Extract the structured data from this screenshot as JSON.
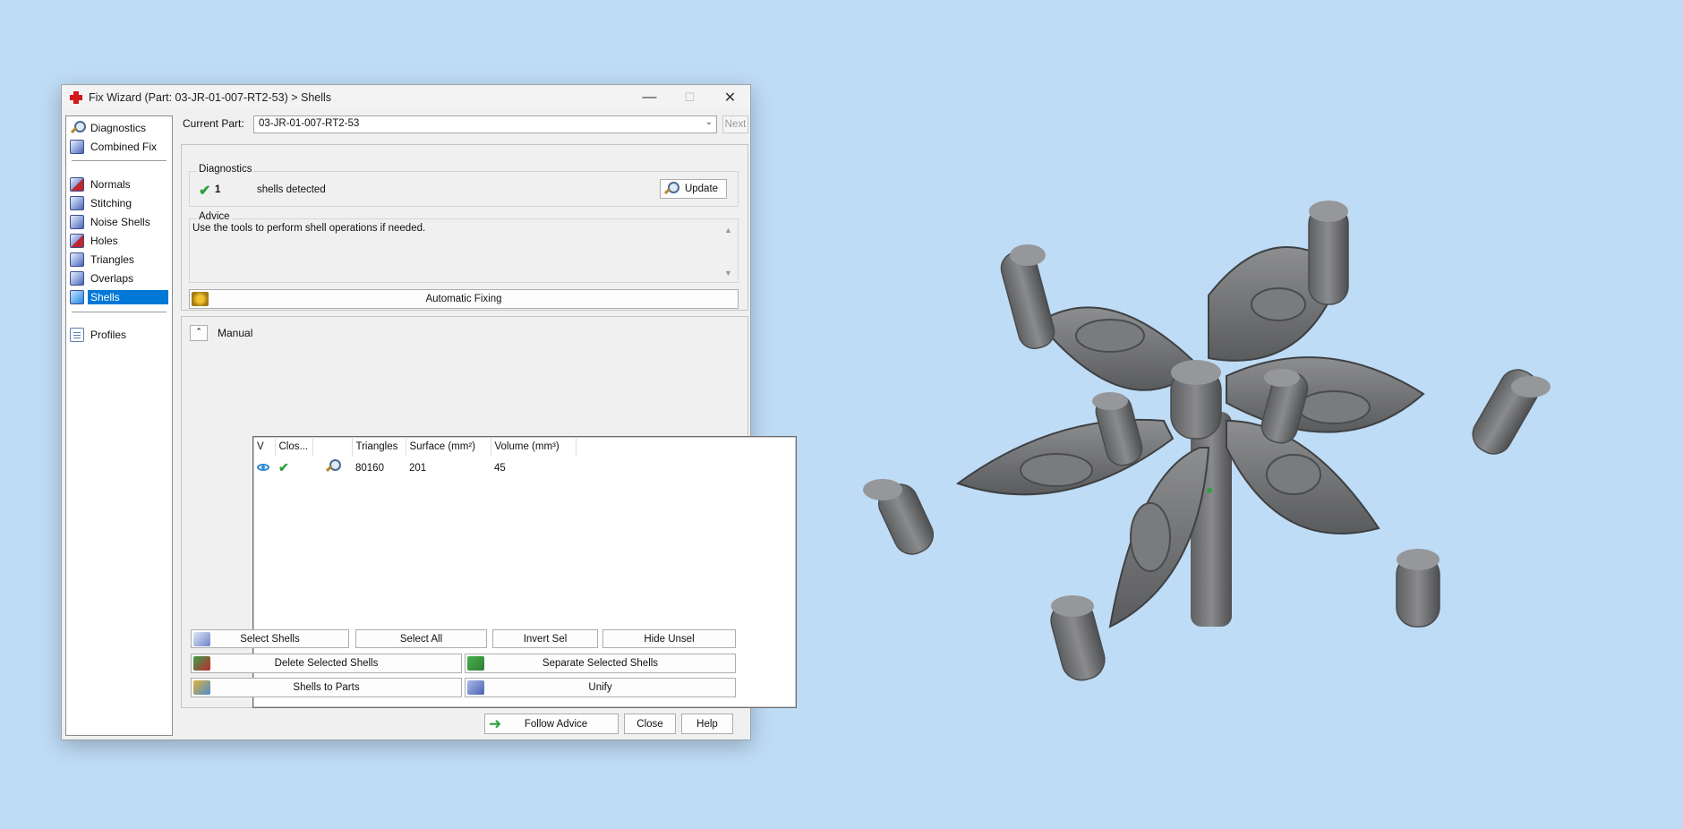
{
  "window": {
    "title": "Fix Wizard (Part: 03-JR-01-007-RT2-53) > Shells",
    "minimize": "—",
    "maximize": "☐",
    "close": "✕"
  },
  "nav": {
    "items": [
      {
        "label": "Diagnostics",
        "icon": "magnifier-icon"
      },
      {
        "label": "Combined Fix",
        "icon": "cube-icon"
      },
      {
        "label": "Normals",
        "icon": "normals-cube-icon"
      },
      {
        "label": "Stitching",
        "icon": "stitching-cube-icon"
      },
      {
        "label": "Noise Shells",
        "icon": "noise-shells-icon"
      },
      {
        "label": "Holes",
        "icon": "holes-cube-icon"
      },
      {
        "label": "Triangles",
        "icon": "triangles-cube-icon"
      },
      {
        "label": "Overlaps",
        "icon": "overlaps-cube-icon"
      },
      {
        "label": "Shells",
        "icon": "shells-cube-icon"
      },
      {
        "label": "Profiles",
        "icon": "document-icon"
      }
    ],
    "active": "Shells"
  },
  "current_part": {
    "label": "Current Part:",
    "value": "03-JR-01-007-RT2-53",
    "next": "Next"
  },
  "diagnostics": {
    "title": "Diagnostics",
    "count": "1",
    "text": "shells detected",
    "update": "Update"
  },
  "advice": {
    "title": "Advice",
    "text": "Use the tools to perform shell operations if needed."
  },
  "automatic_fixing": "Automatic Fixing",
  "manual": {
    "title": "Manual",
    "columns": [
      "V",
      "Clos...",
      "",
      "Triangles",
      "Surface (mm²)",
      "Volume (mm³)"
    ],
    "rows": [
      {
        "triangles": "80160",
        "surface": "201",
        "volume": "45"
      }
    ]
  },
  "buttons": {
    "select_shells": "Select Shells",
    "select_all": "Select All",
    "invert_sel": "Invert Sel",
    "hide_unsel": "Hide Unsel",
    "delete_selected": "Delete Selected Shells",
    "separate_selected": "Separate Selected Shells",
    "shells_to_parts": "Shells to Parts",
    "unify": "Unify",
    "follow_advice": "Follow Advice",
    "close": "Close",
    "help": "Help"
  },
  "colors": {
    "background": "#bfdcf6",
    "accent": "#0078d7",
    "model": "#6e6f71"
  }
}
